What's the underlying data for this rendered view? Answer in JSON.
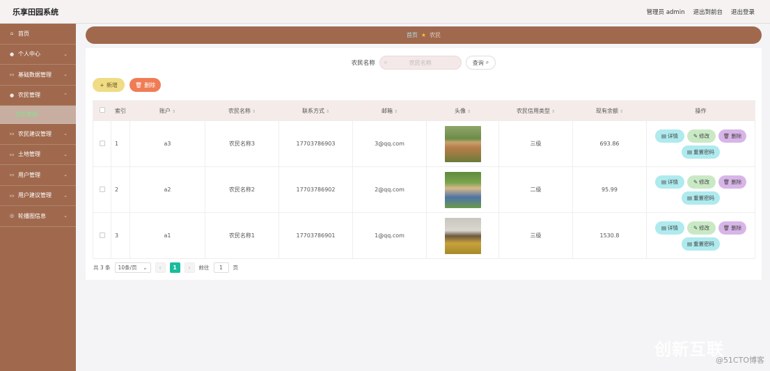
{
  "header": {
    "title": "乐享田园系统",
    "admin": "管理员 admin",
    "to_front": "退出到前台",
    "logout": "退出登录"
  },
  "sidebar": {
    "items": [
      {
        "label": "首页",
        "icon": "home-icon"
      },
      {
        "label": "个人中心",
        "icon": "user-icon"
      },
      {
        "label": "基础数据管理",
        "icon": "list-icon"
      },
      {
        "label": "农民管理",
        "icon": "user-icon"
      }
    ],
    "active_sub": "农民管理",
    "items_after": [
      {
        "label": "农民建议管理",
        "icon": "list-icon"
      },
      {
        "label": "土地管理",
        "icon": "list-icon"
      },
      {
        "label": "用户管理",
        "icon": "list-icon"
      },
      {
        "label": "用户建议管理",
        "icon": "list-icon"
      },
      {
        "label": "轮播图信息",
        "icon": "image-icon"
      }
    ]
  },
  "breadcrumb": {
    "home": "首页",
    "current": "农民"
  },
  "search": {
    "label": "农民名称",
    "placeholder": "农民名称",
    "query_label": "查询"
  },
  "actions": {
    "add_label": "新增",
    "delete_label": "删除"
  },
  "table": {
    "columns": [
      "索引",
      "账户",
      "农民名称",
      "联系方式",
      "邮箱",
      "头像",
      "农民信用类型",
      "现有余额",
      "操作"
    ],
    "rows": [
      {
        "index": "1",
        "account": "a3",
        "name": "农民名称3",
        "phone": "17703786903",
        "email": "3@qq.com",
        "credit": "三级",
        "balance": "693.86"
      },
      {
        "index": "2",
        "account": "a2",
        "name": "农民名称2",
        "phone": "17703786902",
        "email": "2@qq.com",
        "credit": "二级",
        "balance": "95.99"
      },
      {
        "index": "3",
        "account": "a1",
        "name": "农民名称1",
        "phone": "17703786901",
        "email": "1@qq.com",
        "credit": "三级",
        "balance": "1530.8"
      }
    ],
    "row_actions": {
      "detail": "详情",
      "edit": "修改",
      "delete": "删除",
      "reset": "重置密码"
    }
  },
  "pagination": {
    "total": "共 3 条",
    "page_size": "10条/页",
    "current_page": "1",
    "goto_prefix": "前往",
    "goto_value": "1",
    "goto_suffix": "页"
  },
  "watermark": {
    "big": "创新互联",
    "small": "@51CTO博客"
  },
  "colors": {
    "sidebar": "#a0694d",
    "header": "#f6f2f2",
    "accent_green": "#1abc9c",
    "delete_orange": "#f07c55",
    "add_yellow": "#efdc84"
  }
}
